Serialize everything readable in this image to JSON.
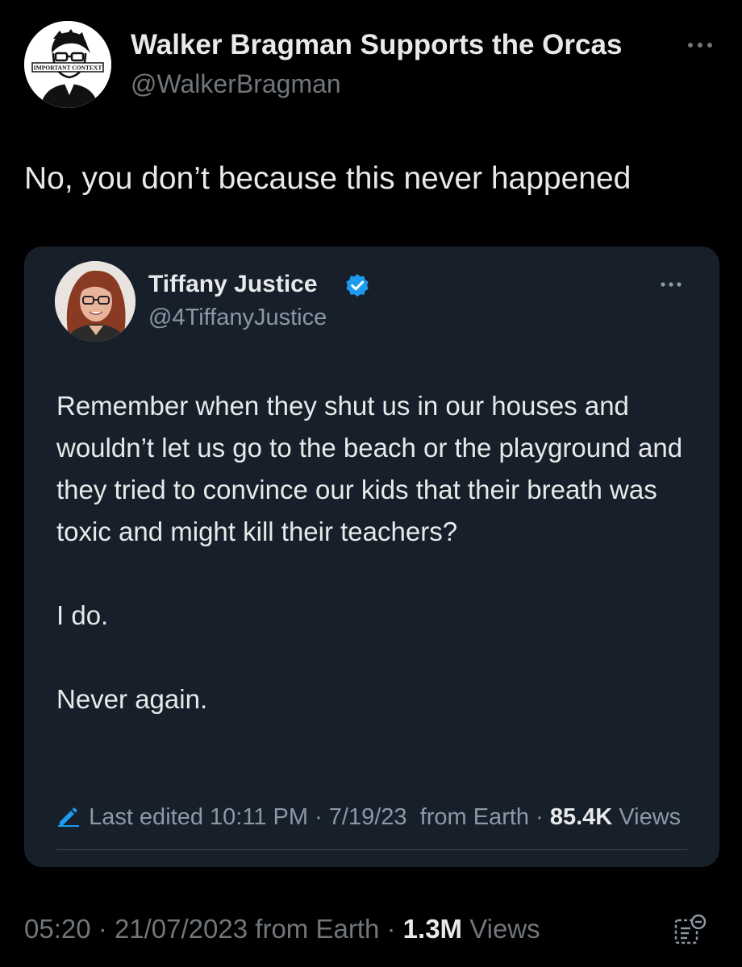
{
  "tweet": {
    "author": {
      "display_name": "Walker Bragman Supports the Orcas",
      "handle": "@WalkerBragman",
      "avatar_text": "IMPORTANT CONTEXT"
    },
    "text": "No, you don’t because this never happened",
    "footer": {
      "time": "05:20",
      "date": "21/07/2023",
      "source": "from Earth",
      "views_count": "1.3M",
      "views_label": "Views"
    }
  },
  "quoted_tweet": {
    "author": {
      "display_name": "Tiffany Justice",
      "handle": "@4TiffanyJustice",
      "verified": true
    },
    "paragraphs": [
      "Remember when they shut us in our houses and wouldn’t let us go to the beach or the playground and they tried to convince our kids that their breath was toxic and might kill their teachers?",
      "I do.",
      "Never again."
    ],
    "meta": {
      "edited_label": "Last edited",
      "time": "10:11 PM",
      "date": "7/19/23",
      "source": "from Earth",
      "views_count": "85.4K",
      "views_label": "Views"
    }
  },
  "colors": {
    "background": "#000000",
    "card": "#17202a",
    "primary_text": "#e7e9ea",
    "secondary_text": "#71767b",
    "accent": "#1d9bf0"
  },
  "icons": {
    "more": "more-horizontal-icon",
    "verified": "verified-badge-icon",
    "edit": "pencil-icon",
    "analytics": "analytics-icon"
  }
}
